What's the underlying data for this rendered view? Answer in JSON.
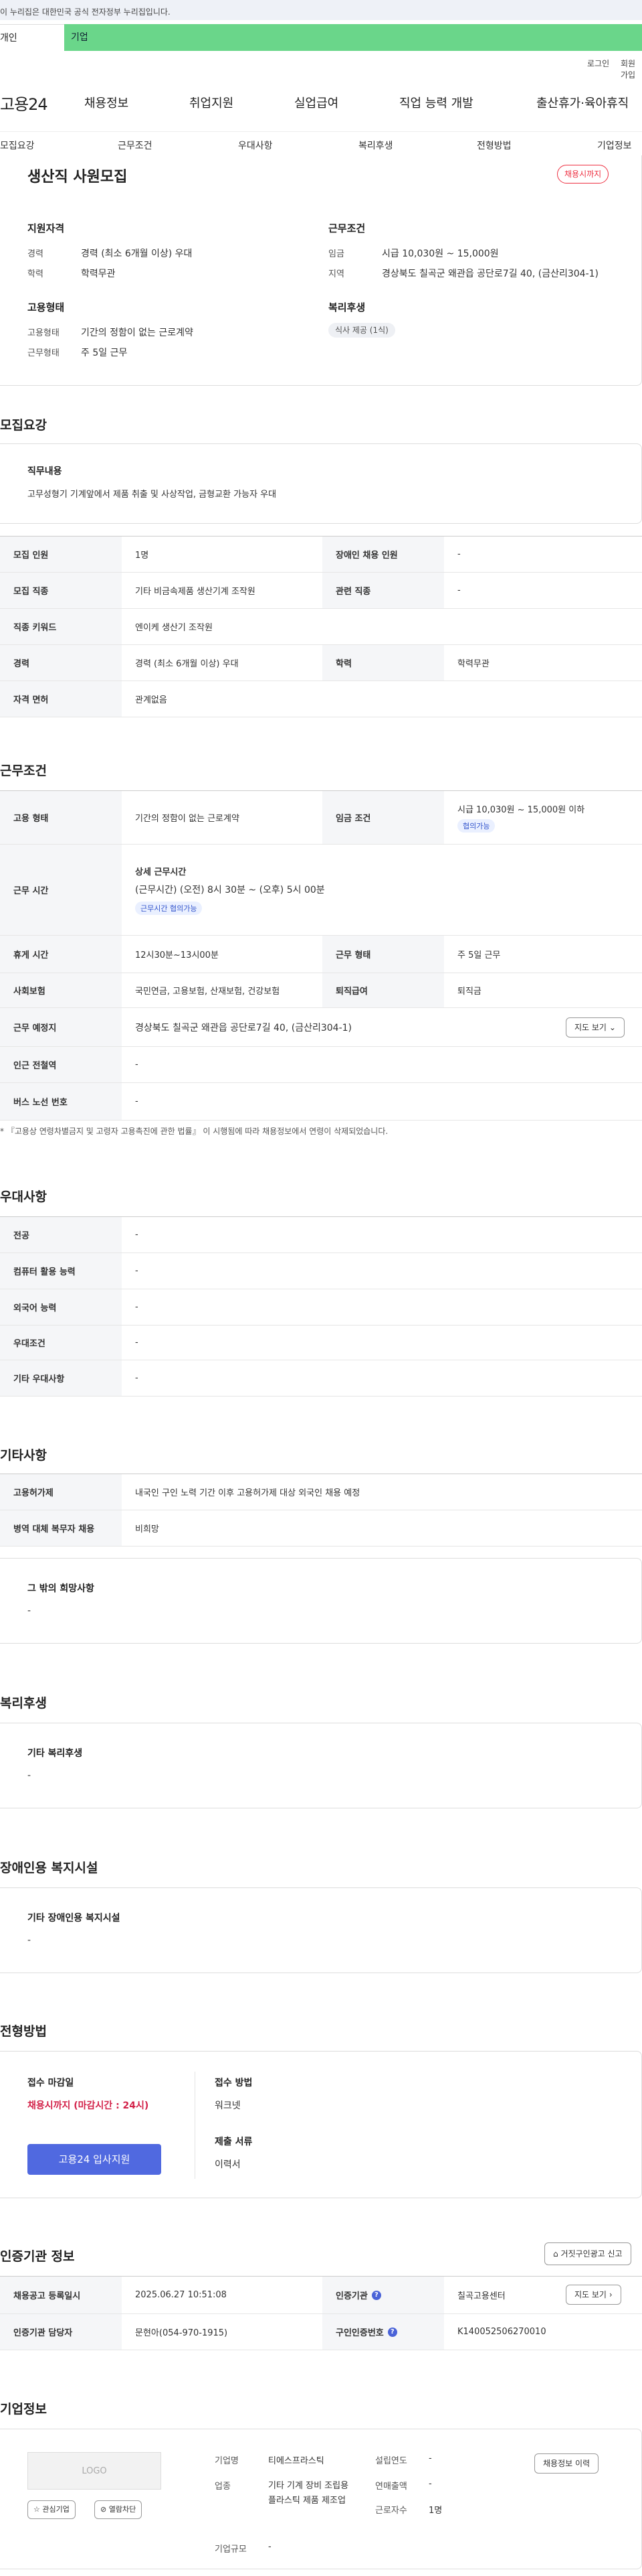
{
  "banner": "이 누리집은 대한민국 공식 전자정부 누리집입니다.",
  "tabs": [
    "개인",
    "기업"
  ],
  "util": {
    "login": "로그인",
    "join": "회원가입"
  },
  "gnb": {
    "logo": "고용24",
    "items": [
      "채용정보",
      "취업지원",
      "실업급여",
      "직업 능력 개발",
      "출산휴가·육아휴직"
    ]
  },
  "lnb": [
    "모집요강",
    "근무조건",
    "우대사항",
    "복리후생",
    "전형방법",
    "기업정보"
  ],
  "summary": {
    "title": "생산직 사원모집",
    "status": "채용시까지",
    "qual_title": "지원자격",
    "qual": [
      {
        "k": "경력",
        "v": "경력 (최소 6개월 이상) 우대"
      },
      {
        "k": "학력",
        "v": "학력무관"
      }
    ],
    "cond_title": "근무조건",
    "cond": [
      {
        "k": "임금",
        "v": "시급 10,030원 ~ 15,000원"
      },
      {
        "k": "지역",
        "v": "경상북도 칠곡군 왜관읍 공단로7길 40, (금산리304-1)"
      }
    ],
    "emp_title": "고용형태",
    "emp": [
      {
        "k": "고용형태",
        "v": "기간의 정함이 없는 근로계약"
      },
      {
        "k": "근무형태",
        "v": "주 5일 근무"
      }
    ],
    "welfare_title": "복리후생",
    "welfare_chip": "식사 제공 (1식)"
  },
  "recruit": {
    "heading": "모집요강",
    "duty_title": "직무내용",
    "duty_text": "고무성형기 기계앞에서 제품 취출 및 사상작업, 금형교환 가능자 우대",
    "rows": [
      [
        "모집 인원",
        "1명",
        "장애인 채용 인원",
        "-"
      ],
      [
        "모집 직종",
        "기타 비금속제품 생산기계 조작원",
        "관련 직종",
        "-"
      ],
      [
        "직종 키워드",
        "엔이케 생산기 조작원",
        "",
        ""
      ],
      [
        "경력",
        "경력 (최소 6개월 이상) 우대",
        "학력",
        "학력무관"
      ],
      [
        "자격 면허",
        "관계없음",
        "",
        ""
      ]
    ]
  },
  "work": {
    "heading": "근무조건",
    "emp_type_k": "고용 형태",
    "emp_type_v": "기간의 정함이 없는 근로계약",
    "wage_k": "임금 조건",
    "wage_v": "시급 10,030원 ~ 15,000원 이하",
    "wage_badge": "협의가능",
    "hours_k": "근무 시간",
    "hours_title": "상세 근무시간",
    "hours_v": "(근무시간) (오전) 8시 30분 ~ (오후) 5시 00분",
    "hours_badge": "근무시간 협의가능",
    "rest_k": "휴게 시간",
    "rest_v": "12시30분~13시00분",
    "form_k": "근무 형태",
    "form_v": "주 5일 근무",
    "ins_k": "사회보험",
    "ins_v": "국민연금, 고용보험, 산재보험, 건강보험",
    "ret_k": "퇴직급여",
    "ret_v": "퇴직금",
    "place_k": "근무 예정지",
    "place_v": "경상북도 칠곡군 왜관읍 공단로7길 40, (금산리304-1)",
    "map_btn": "지도 보기",
    "sub_k": "인근 전철역",
    "sub_v": "-",
    "bus_k": "버스 노선 번호",
    "bus_v": "-",
    "note": "* 『고용상 연령차별금지 및 고령자 고용촉진에 관한 법률』 이 시행됨에 따라 채용정보에서 연령이 삭제되었습니다."
  },
  "pref": {
    "heading": "우대사항",
    "rows": [
      [
        "전공",
        "-"
      ],
      [
        "컴퓨터 활용 능력",
        "-"
      ],
      [
        "외국어 능력",
        "-"
      ],
      [
        "우대조건",
        "-"
      ],
      [
        "기타 우대사항",
        "-"
      ]
    ]
  },
  "etc": {
    "heading": "기타사항",
    "rows": [
      [
        "고용허가제",
        "내국인 구인 노력 기간 이후 고용허가제 대상 외국인 채용 예정"
      ],
      [
        "병역 대체 복무자 채용",
        "비희망"
      ]
    ],
    "wish_title": "그 밖의 희망사항",
    "wish_v": "-"
  },
  "welfare": {
    "heading": "복리후생",
    "title": "기타 복리후생",
    "v": "-"
  },
  "disabled": {
    "heading": "장애인용 복지시설",
    "title": "기타 장애인용 복지시설",
    "v": "-"
  },
  "screen": {
    "heading": "전형방법",
    "deadline_k": "접수 마감일",
    "deadline_v": "채용시까지 (마감시간 : 24시)",
    "apply_btn": "고용24 입사지원",
    "method_k": "접수 방법",
    "method_v": "워크넷",
    "docs_k": "제출 서류",
    "docs_v": "이력서"
  },
  "cert": {
    "heading": "인증기관 정보",
    "report_btn": "거짓구인광고 신고",
    "reg_k": "채용공고 등록일시",
    "reg_v": "2025.06.27 10:51:08",
    "org_k": "인증기관",
    "org_v": "칠곡고용센터",
    "map_btn": "지도 보기",
    "mgr_k": "인증기관 담당자",
    "mgr_v": "문현아(054-970-1915)",
    "num_k": "구인인증번호",
    "num_v": "K140052506270010"
  },
  "company": {
    "heading": "기업정보",
    "logo": "LOGO",
    "fav_btn": "관심기업",
    "block_btn": "열람차단",
    "name_k": "기업명",
    "name_v": "티에스프라스틱",
    "ind_k": "업종",
    "ind_v": "기타 기계 장비 조립용 플라스틱 제품 제조업",
    "size_k": "기업규모",
    "size_v": "-",
    "year_k": "설립연도",
    "year_v": "-",
    "sales_k": "연매출액",
    "sales_v": "-",
    "emp_k": "근로자수",
    "emp_v": "1명",
    "hist_btn": "채용정보 이력"
  }
}
